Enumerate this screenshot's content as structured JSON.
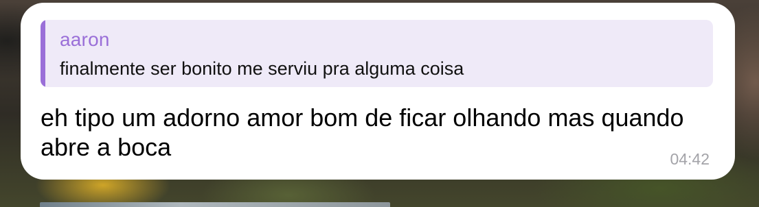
{
  "message": {
    "reply_quote": {
      "author": "aaron",
      "text": "finalmente ser bonito me serviu pra alguma coisa",
      "accent_color": "#9a6fd8",
      "background_color": "#efeaf8"
    },
    "text": "eh tipo um adorno amor bom de ficar olhando mas quando abre a boca",
    "time": "04:42"
  }
}
